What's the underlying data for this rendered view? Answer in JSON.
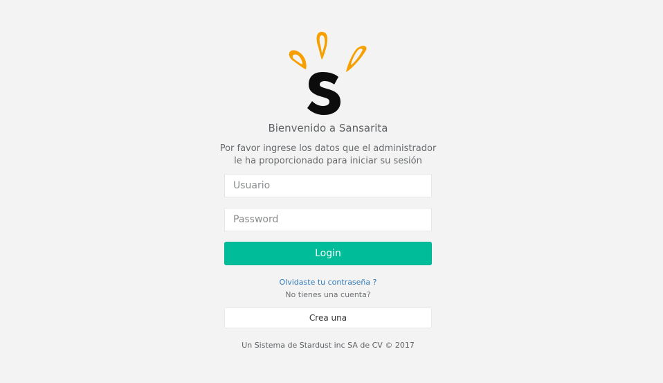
{
  "brand": {
    "logo_icon": "sansarita-logo",
    "accent_color": "#f5a000",
    "primary_color": "#00bc98"
  },
  "welcome_title": "Bienvenido a Sansarita",
  "subtitle_line1": "Por favor ingrese los datos que el administrador",
  "subtitle_line2": "le ha proporcionado para iniciar su sesión",
  "form": {
    "username_placeholder": "Usuario",
    "username_value": "",
    "password_placeholder": "Password",
    "password_value": "",
    "login_label": "Login"
  },
  "forgot_link": "Olvidaste tu contraseña ?",
  "no_account_text": "No tienes una cuenta?",
  "create_account_label": "Crea una",
  "footer_text": "Un Sistema de Stardust inc SA de CV © 2017"
}
